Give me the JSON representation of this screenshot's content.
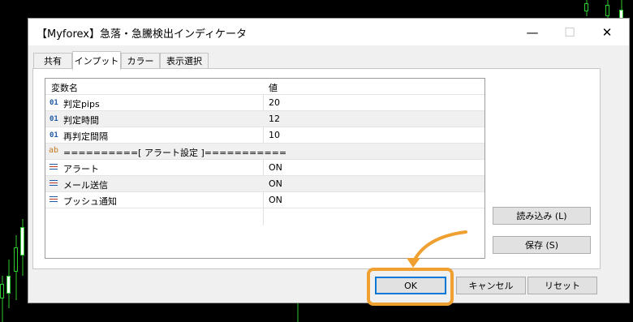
{
  "window": {
    "title": "【Myforex】急落・急騰検出インディケータ",
    "minimize": "—",
    "maximize": "☐",
    "close": "✕"
  },
  "tabs": [
    {
      "label": "共有"
    },
    {
      "label": "インプット"
    },
    {
      "label": "カラー"
    },
    {
      "label": "表示選択"
    }
  ],
  "grid": {
    "header": {
      "name": "変数名",
      "value": "値"
    },
    "rows": [
      {
        "type": "01",
        "name": "判定pips",
        "value": "20"
      },
      {
        "type": "01",
        "name": "判定時間",
        "value": "12"
      },
      {
        "type": "01",
        "name": "再判定間隔",
        "value": "10"
      },
      {
        "type": "ab",
        "name": "==========[ アラート設定 ]===========",
        "value": ""
      },
      {
        "type": "list",
        "name": "アラート",
        "value": "ON"
      },
      {
        "type": "list",
        "name": "メール送信",
        "value": "ON"
      },
      {
        "type": "list",
        "name": "プッシュ通知",
        "value": "ON"
      }
    ]
  },
  "buttons": {
    "load": "読み込み (L)",
    "save": "保存 (S)",
    "ok": "OK",
    "cancel": "キャンセル",
    "reset": "リセット"
  },
  "icons": {
    "int_param": "01",
    "string_param": "ab",
    "enum_param": "list-icon"
  },
  "colors": {
    "highlight": "#f0a030",
    "candle": "#2ecc2e",
    "focus": "#0078d7"
  }
}
